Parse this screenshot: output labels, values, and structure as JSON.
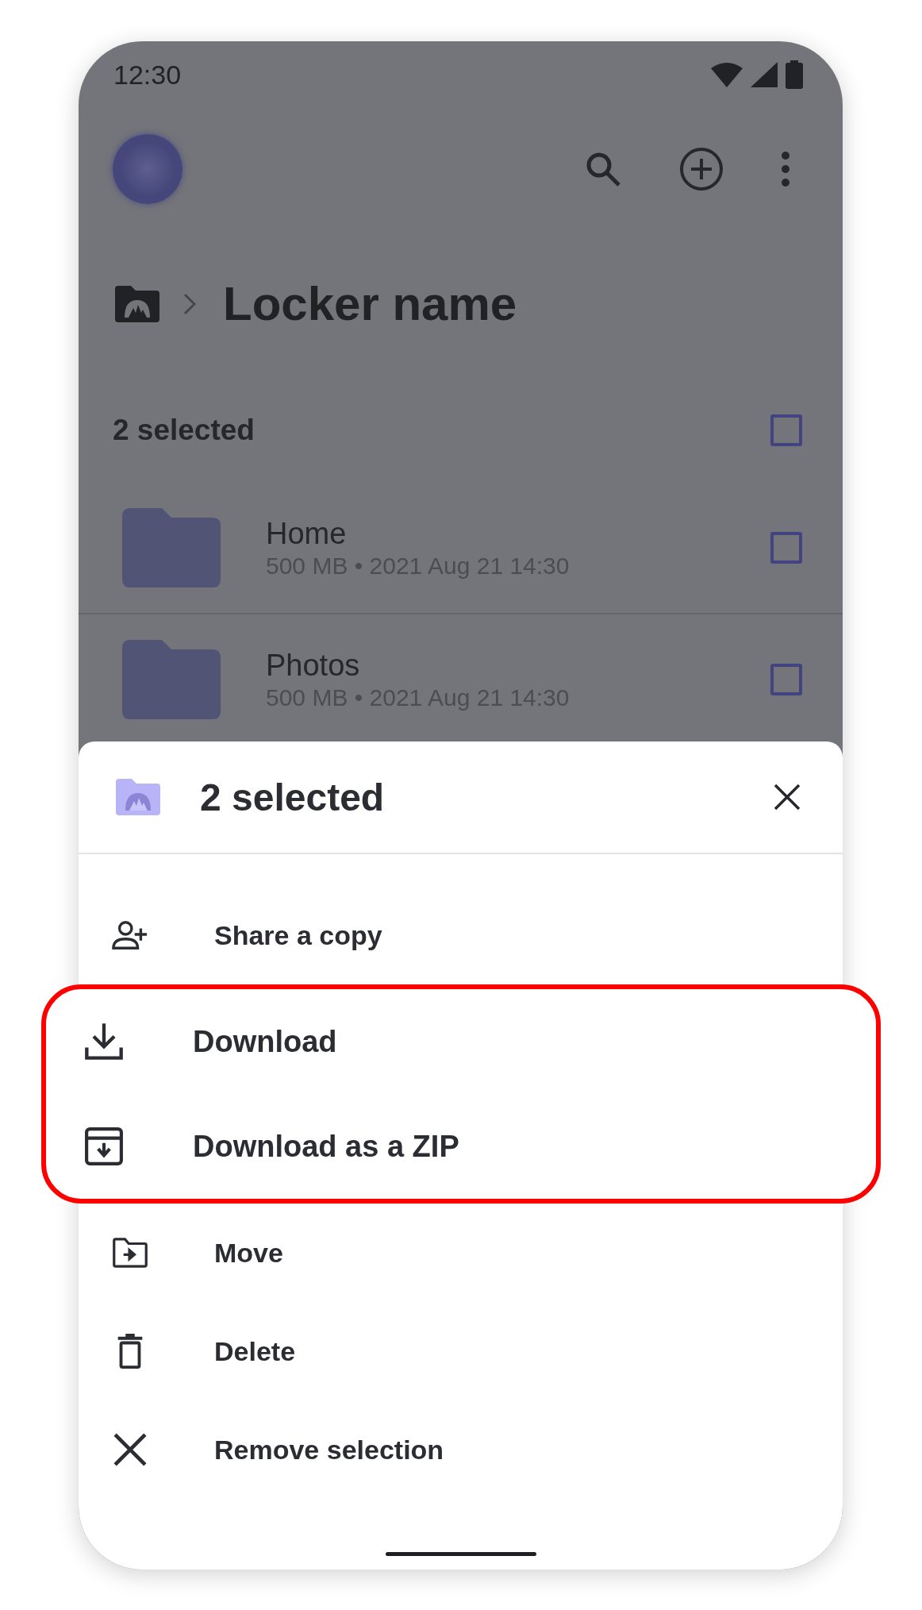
{
  "status_bar": {
    "time": "12:30"
  },
  "breadcrumb": {
    "title": "Locker name"
  },
  "selection": {
    "label": "2 selected",
    "checked": false
  },
  "files": [
    {
      "name": "Home",
      "meta": "500 MB • 2021 Aug 21 14:30",
      "checked": false
    },
    {
      "name": "Photos",
      "meta": "500 MB • 2021 Aug 21 14:30",
      "checked": false
    }
  ],
  "sheet": {
    "title": "2 selected",
    "actions": [
      {
        "label": "Share a copy",
        "kind": "share",
        "highlighted": false
      },
      {
        "label": "Download",
        "kind": "download",
        "highlighted": true
      },
      {
        "label": "Download as a ZIP",
        "kind": "zip",
        "highlighted": true
      },
      {
        "label": "Move",
        "kind": "move",
        "highlighted": false
      },
      {
        "label": "Delete",
        "kind": "delete",
        "highlighted": false
      },
      {
        "label": "Remove selection",
        "kind": "remove",
        "highlighted": false
      }
    ]
  }
}
